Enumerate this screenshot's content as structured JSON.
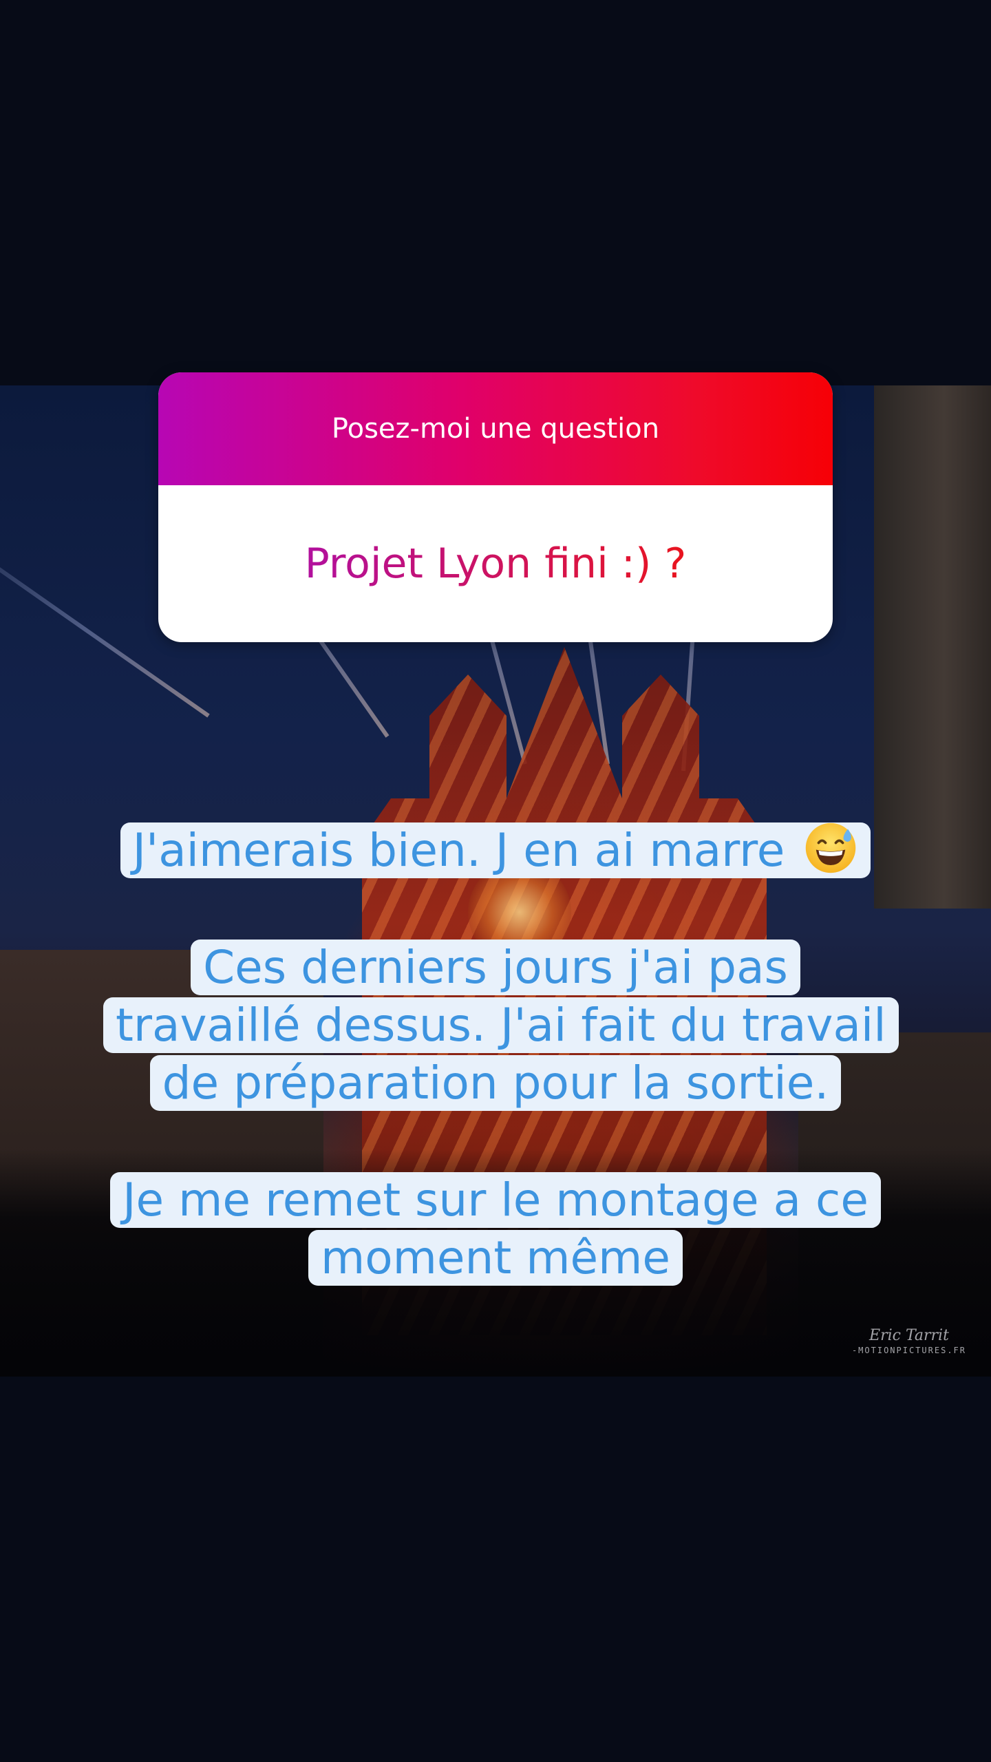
{
  "question_sticker": {
    "header": "Posez-moi une question",
    "question": "Projet Lyon fini :) ?"
  },
  "answers": [
    {
      "text": "J'aimerais bien. J en ai marre",
      "emoji": "grinning-face-with-sweat-icon"
    },
    {
      "text": "Ces derniers jours j'ai pas travaillé dessus. J'ai fait du travail de préparation pour la sortie."
    },
    {
      "text": "Je me remet sur le montage a ce moment même"
    }
  ],
  "photo": {
    "watermark_signature": "Eric Tarrit",
    "watermark_site": "-MOTIONPICTURES.FR"
  },
  "colors": {
    "sticker_gradient_start": "#b706b4",
    "sticker_gradient_end": "#f60006",
    "answer_text": "#3d94e0",
    "answer_highlight": "#e8f1fb",
    "background": "#070b18"
  }
}
